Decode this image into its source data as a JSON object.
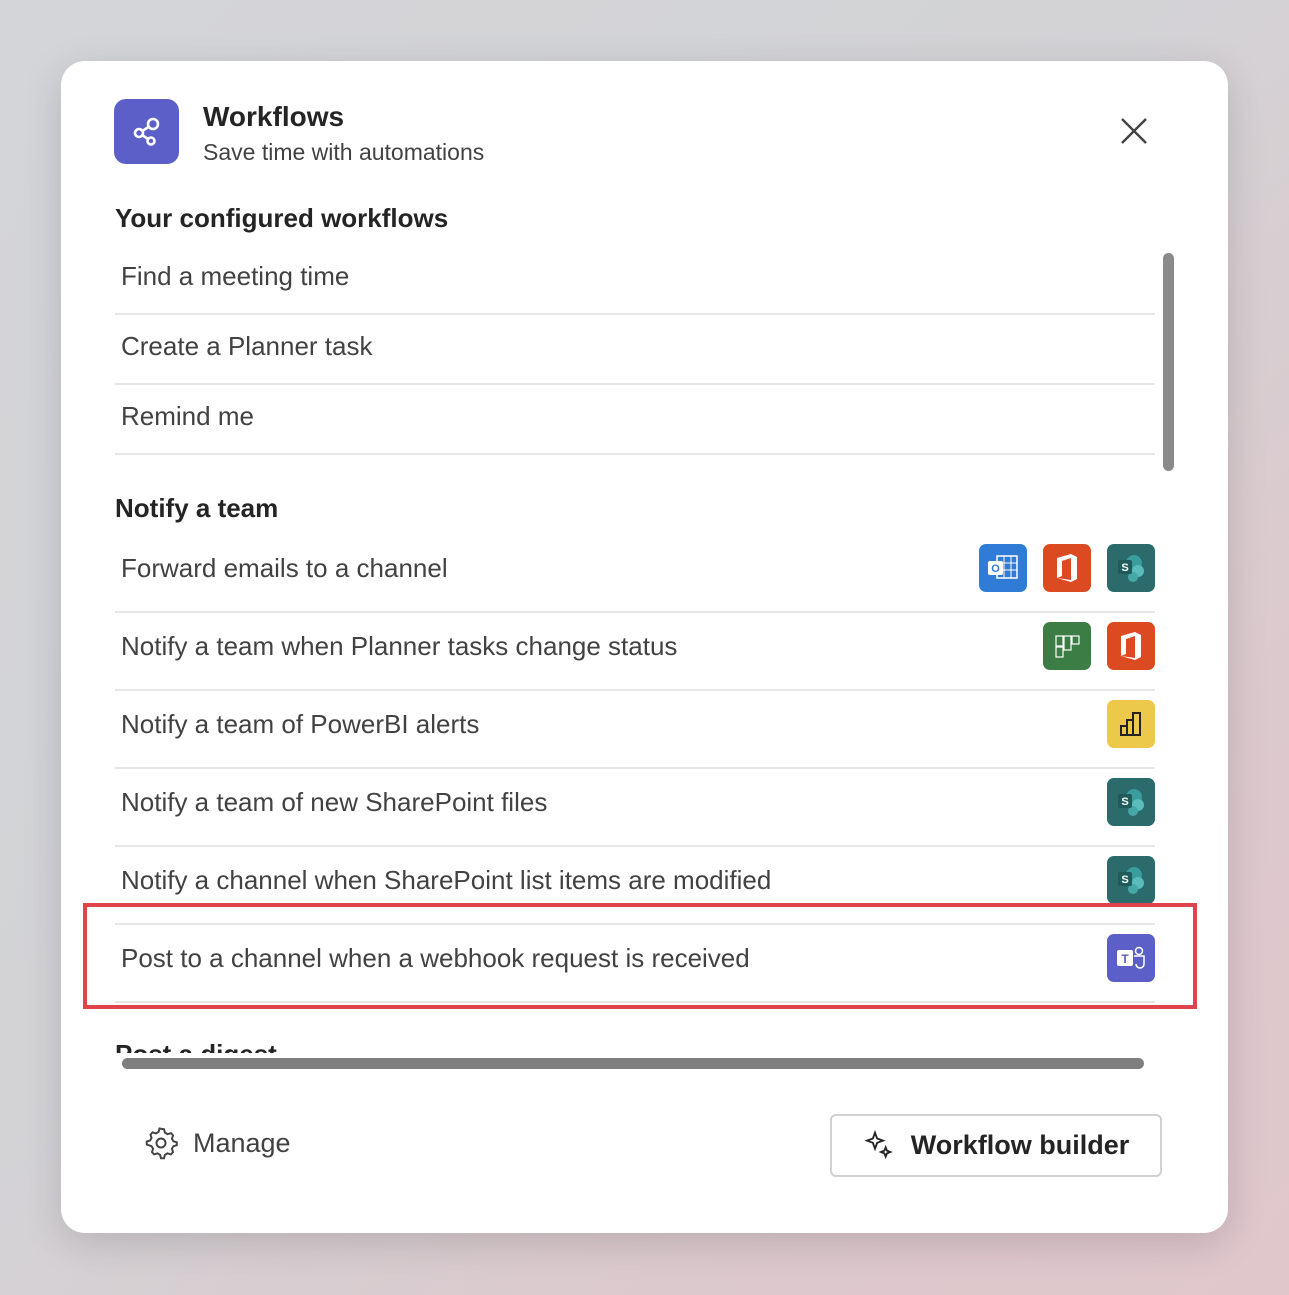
{
  "header": {
    "title": "Workflows",
    "subtitle": "Save time with automations"
  },
  "sections": [
    {
      "title": "Your configured workflows",
      "items": [
        {
          "label": "Find a meeting time"
        },
        {
          "label": "Create a Planner task"
        },
        {
          "label": "Remind me"
        }
      ]
    },
    {
      "title": "Notify a team",
      "items": [
        {
          "label": "Forward emails to a channel",
          "icons": [
            "outlook",
            "office",
            "sharepoint"
          ]
        },
        {
          "label": "Notify a team when Planner tasks change status",
          "icons": [
            "planner",
            "office"
          ]
        },
        {
          "label": "Notify a team of PowerBI alerts",
          "icons": [
            "powerbi"
          ]
        },
        {
          "label": "Notify a team of new SharePoint files",
          "icons": [
            "sharepoint"
          ]
        },
        {
          "label": "Notify a channel when SharePoint list items are modified",
          "icons": [
            "sharepoint"
          ]
        },
        {
          "label": "Post to a channel when a webhook request is received",
          "icons": [
            "teams"
          ],
          "highlighted": true
        }
      ]
    },
    {
      "title": "Post a digest",
      "items": []
    }
  ],
  "footer": {
    "manage": "Manage",
    "builder": "Workflow builder"
  },
  "colors": {
    "accent": "#5b5fc7",
    "highlight": "#e0434a",
    "outlook": "#2f7bd6",
    "office": "#dc4a22",
    "sharepoint": "#2b6b6b",
    "planner": "#3c7d45",
    "powerbi": "#ecc94b",
    "teams": "#5b5fc7"
  }
}
